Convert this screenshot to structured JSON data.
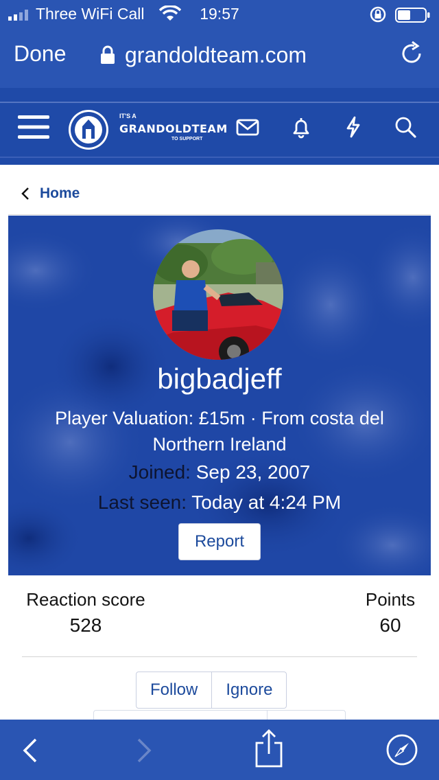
{
  "status_bar": {
    "carrier": "Three WiFi Call",
    "time": "19:57",
    "icons": [
      "signal-icon",
      "wifi-icon",
      "orientation-lock-icon",
      "battery-icon"
    ]
  },
  "browser": {
    "done_label": "Done",
    "url": "grandoldteam.com",
    "icons": [
      "padlock-icon",
      "reload-icon"
    ]
  },
  "site_header": {
    "brand_line1": "IT'S A",
    "brand_line2": "GRANDOLDTEAM",
    "brand_line3": "TO SUPPORT",
    "icons": [
      "menu-icon",
      "mail-icon",
      "bell-icon",
      "lightning-icon",
      "search-icon"
    ]
  },
  "breadcrumb": {
    "label": "Home"
  },
  "profile": {
    "username": "bigbadjeff",
    "valuation": "Player Valuation: £15m · From costa del Northern Ireland",
    "joined_label": "Joined:",
    "joined_value": "Sep 23, 2007",
    "last_seen_label": "Last seen:",
    "last_seen_value": "Today at 4:24 PM",
    "report_label": "Report"
  },
  "stats": {
    "reaction_label": "Reaction score",
    "reaction_value": "528",
    "points_label": "Points",
    "points_value": "60"
  },
  "actions": {
    "follow_label": "Follow",
    "ignore_label": "Ignore"
  },
  "toolbar": {
    "icons": [
      "back-arrow-icon",
      "forward-arrow-icon",
      "share-icon",
      "compass-icon"
    ]
  },
  "colors": {
    "browser_chrome": "#2a55b3",
    "site_header": "#1f4aa8",
    "banner": "#1f47a6",
    "link": "#1c4a9c"
  }
}
